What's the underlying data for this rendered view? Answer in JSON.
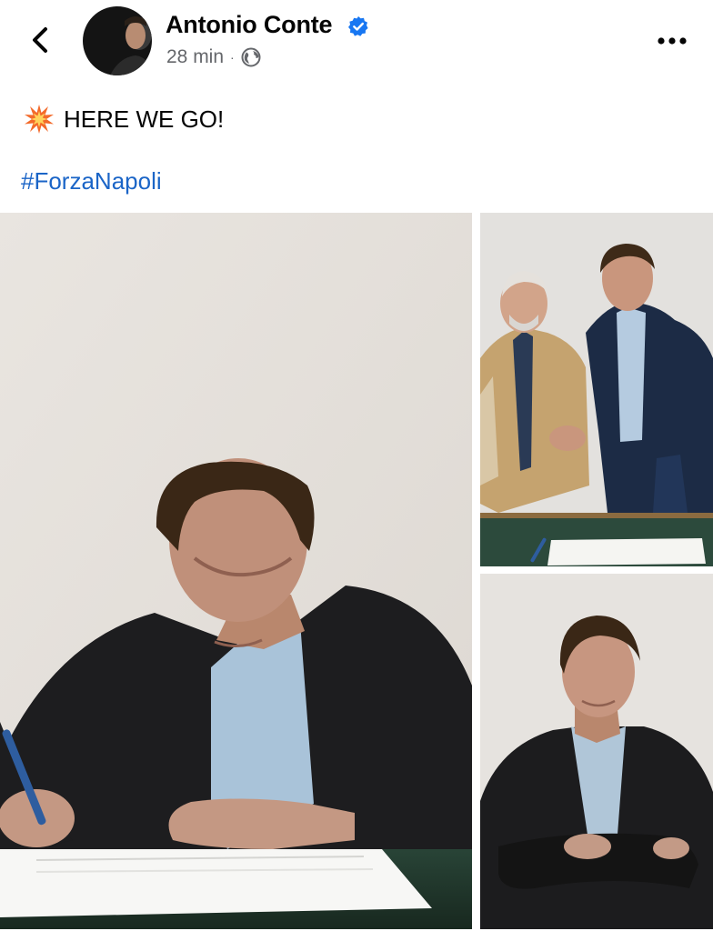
{
  "header": {
    "author": "Antonio Conte",
    "time": "28 min",
    "separator": "·",
    "icons": {
      "back": "chevron-left-icon",
      "verified": "verified-badge-icon",
      "audience": "globe-icon",
      "menu": "more-horizontal-icon"
    }
  },
  "post": {
    "emoji": "collision-emoji",
    "text": "HERE WE GO!",
    "hashtag": "#ForzaNapoli"
  },
  "colors": {
    "verified": "#1877f2",
    "hashtag": "#1b65c7",
    "meta": "#65676b"
  }
}
